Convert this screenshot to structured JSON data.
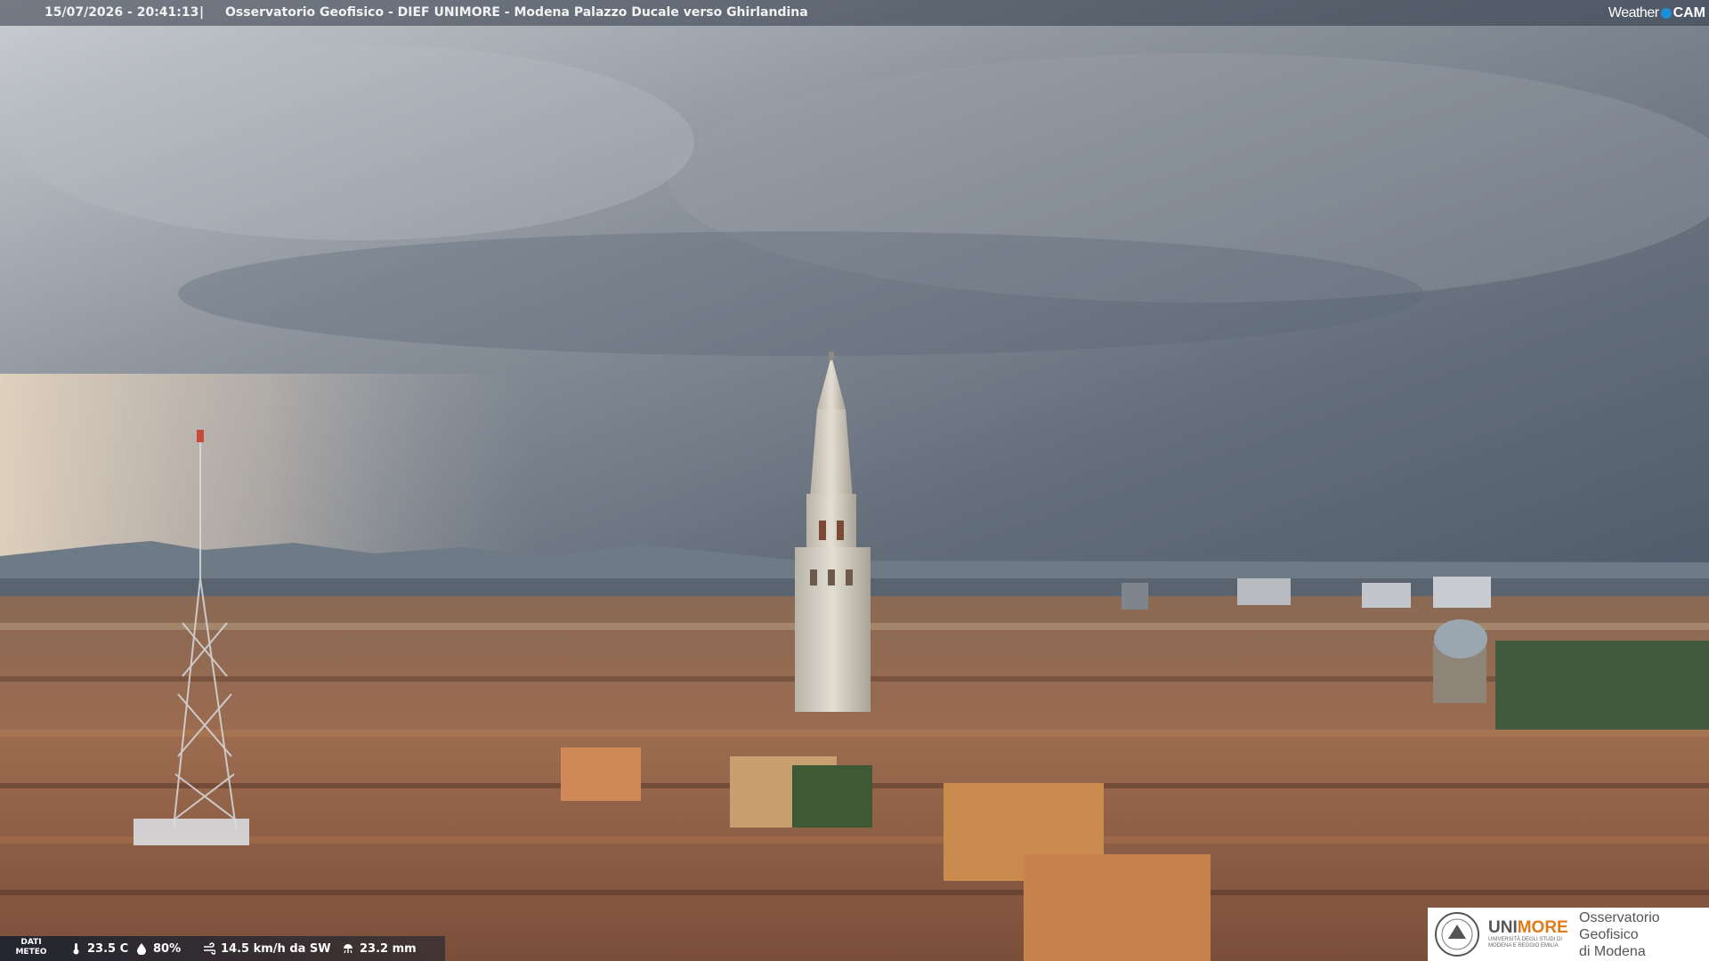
{
  "header": {
    "timestamp": "15/07/2026 - 20:41:13",
    "separator": "|",
    "location": "Osservatorio Geofisico - DIEF UNIMORE - Modena Palazzo Ducale verso Ghirlandina"
  },
  "brand": {
    "weather": "Weather",
    "cam": "CAM"
  },
  "weather_data": {
    "label": "DATI METEO",
    "temperature": "23.5 C",
    "humidity": "80%",
    "wind": "14.5 km/h da SW",
    "rain": "23.2 mm"
  },
  "logo": {
    "unimore_part1": "UNI",
    "unimore_part2": "MORE",
    "university_subtitle": "UNIVERSITÀ DEGLI STUDI DI MODENA E REGGIO EMILIA",
    "observatory_line1": "Osservatorio Geofisico",
    "observatory_line2": "di Modena"
  },
  "colors": {
    "accent_orange": "#e07b1a",
    "brand_blue": "#1a8fd8"
  }
}
